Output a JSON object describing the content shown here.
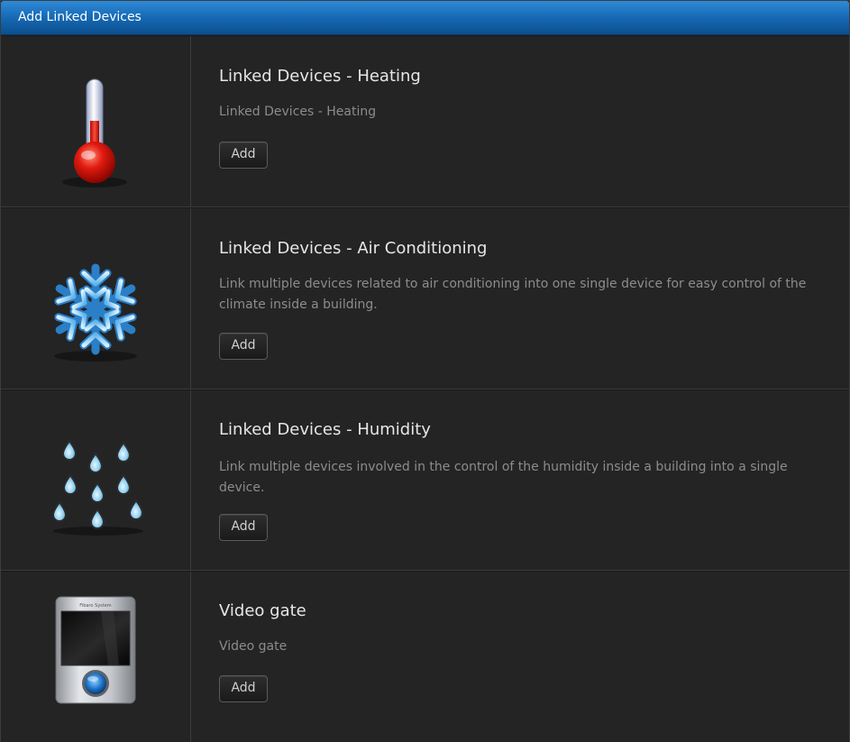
{
  "header": {
    "title": "Add Linked Devices"
  },
  "items": [
    {
      "icon": "thermometer-icon",
      "title": "Linked Devices - Heating",
      "description": "Linked Devices - Heating",
      "button_label": "Add"
    },
    {
      "icon": "snowflake-icon",
      "title": "Linked Devices - Air Conditioning",
      "description": "Link multiple devices related to air conditioning into one single device for easy control of the climate inside a building.",
      "button_label": "Add"
    },
    {
      "icon": "water-drops-icon",
      "title": "Linked Devices - Humidity",
      "description": "Link multiple devices involved in the control of the humidity inside a building into a single device.",
      "button_label": "Add"
    },
    {
      "icon": "video-gate-icon",
      "title": "Video gate",
      "description": "Video gate",
      "button_label": "Add",
      "icon_brand_text": "Fibaro System"
    }
  ],
  "colors": {
    "header_blue": "#1669b4",
    "background": "#262626",
    "title_text": "#e6e6e6",
    "description_text": "#8c8c8c"
  }
}
